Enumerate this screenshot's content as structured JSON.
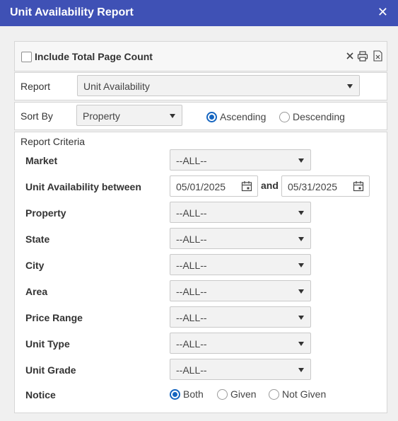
{
  "window": {
    "title": "Unit Availability Report",
    "close_icon": "close-icon"
  },
  "toolbar": {
    "include_total_page_count_label": "Include Total Page Count",
    "include_total_page_count_checked": false,
    "icons": [
      "close-icon",
      "print-icon",
      "excel-export-icon"
    ]
  },
  "report": {
    "label": "Report",
    "value": "Unit Availability"
  },
  "sort": {
    "label": "Sort By",
    "value": "Property",
    "ascending_label": "Ascending",
    "descending_label": "Descending",
    "selected": "Ascending"
  },
  "criteria": {
    "heading": "Report Criteria",
    "market": {
      "label": "Market",
      "value": "--ALL--"
    },
    "availability": {
      "label": "Unit Availability between",
      "from": "05/01/2025",
      "joiner": "and",
      "to": "05/31/2025"
    },
    "property": {
      "label": "Property",
      "value": "--ALL--"
    },
    "state": {
      "label": "State",
      "value": "--ALL--"
    },
    "city": {
      "label": "City",
      "value": "--ALL--"
    },
    "area": {
      "label": "Area",
      "value": "--ALL--"
    },
    "price_range": {
      "label": "Price Range",
      "value": "--ALL--"
    },
    "unit_type": {
      "label": "Unit Type",
      "value": "--ALL--"
    },
    "unit_grade": {
      "label": "Unit Grade",
      "value": "--ALL--"
    },
    "notice": {
      "label": "Notice",
      "options": [
        "Both",
        "Given",
        "Not Given"
      ],
      "selected": "Both"
    }
  },
  "colors": {
    "titlebar": "#3f51b5",
    "radio_accent": "#1565c0",
    "background": "#f0f0f0"
  }
}
